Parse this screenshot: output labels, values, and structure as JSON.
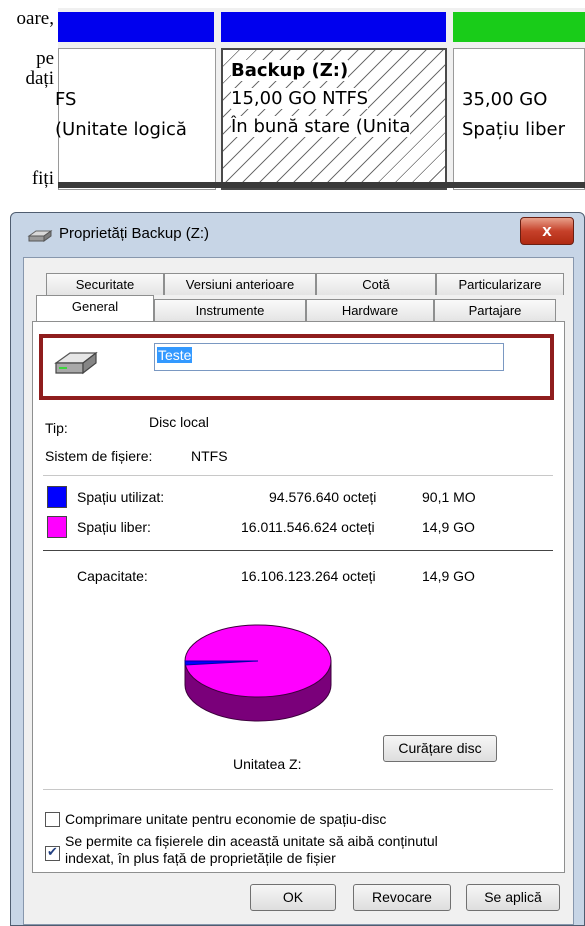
{
  "document_fragments": [
    "oare,",
    "pe",
    "dați",
    "fiți"
  ],
  "disk_strip": {
    "colors": {
      "primary": "#0000ff",
      "logical": "#0022dd",
      "free": "#18c818"
    },
    "partitions": [
      {
        "line1": "FS",
        "line2": "(Unitate logică"
      },
      {
        "line0": "Backup  (Z:)",
        "line1": "15,00 GO NTFS",
        "line2": "În bună stare (Unita"
      },
      {
        "line1": "35,00 GO",
        "line2": "Spațiu liber"
      }
    ]
  },
  "dialog": {
    "title": "Proprietăți Backup (Z:)",
    "close_label": "x",
    "tabs_row1": [
      "Securitate",
      "Versiuni anterioare",
      "Cotă",
      "Particularizare"
    ],
    "tabs_row2": [
      "General",
      "Instrumente",
      "Hardware",
      "Partajare"
    ],
    "active_tab": "General",
    "volume_name": "Teste",
    "type_label": "Tip:",
    "type_value": "Disc local",
    "fs_label": "Sistem de fișiere:",
    "fs_value": "NTFS",
    "used": {
      "label": "Spațiu utilizat:",
      "bytes": "94.576.640 octeți",
      "size": "90,1 MO",
      "color": "#0000ff"
    },
    "free": {
      "label": "Spațiu liber:",
      "bytes": "16.011.546.624 octeți",
      "size": "14,9 GO",
      "color": "#ff00ff"
    },
    "capacity": {
      "label": "Capacitate:",
      "bytes": "16.106.123.264 octeți",
      "size": "14,9 GO"
    },
    "used_fraction": 0.0059,
    "drive_label": "Unitatea Z:",
    "cleanup_button": "Curățare disc",
    "compress_label": "Comprimare unitate pentru economie de spațiu-disc",
    "compress_checked": false,
    "index_label_1": "Se permite ca fișierele din această unitate să aibă conținutul",
    "index_label_2": "indexat, în plus față de proprietățile de fișier",
    "index_checked": true,
    "ok_button": "OK",
    "cancel_button": "Revocare",
    "apply_button": "Se aplică"
  }
}
